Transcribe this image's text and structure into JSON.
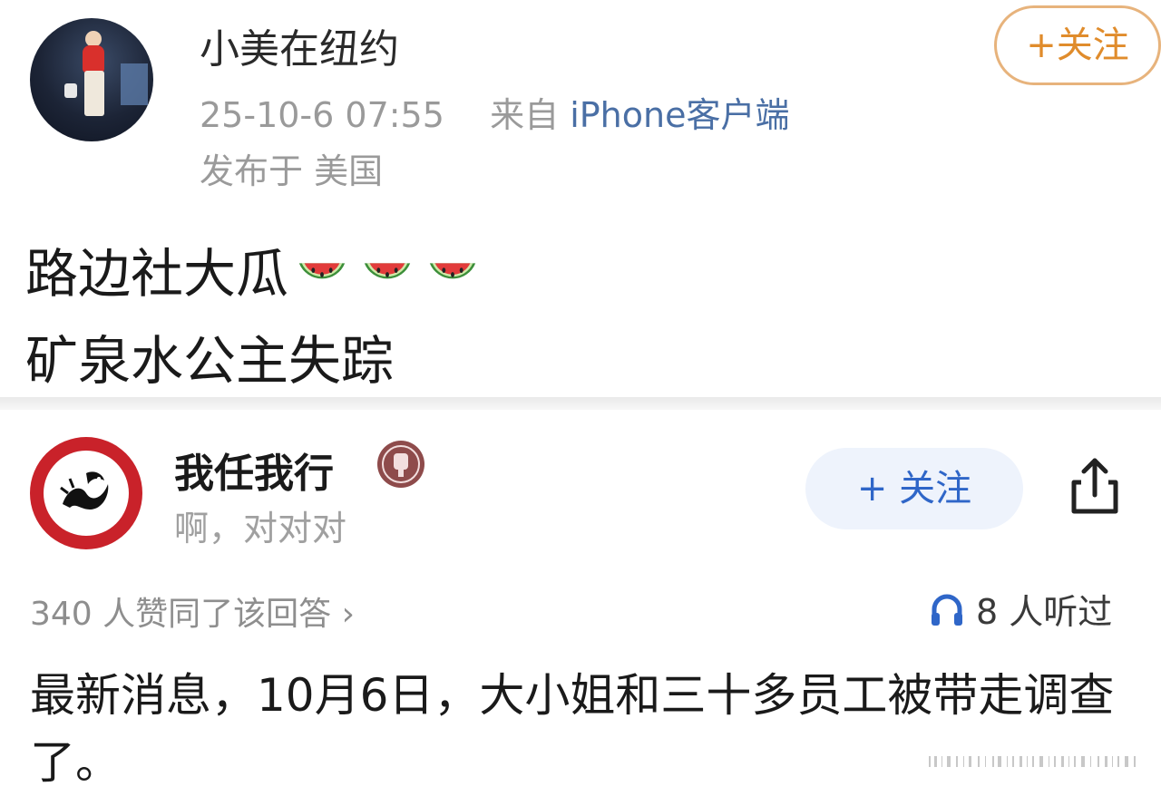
{
  "post1": {
    "author": "小美在纽约",
    "timestamp": "25-10-6 07:55",
    "from_label": "来自",
    "source": "iPhone客户端",
    "location": "发布于 美国",
    "follow_label": "+关注",
    "content_line1": "路边社大瓜",
    "content_line2": "矿泉水公主失踪",
    "emoji_icon": "watermelon-icon"
  },
  "post2": {
    "author": "我任我行",
    "subtitle": "啊，对对对",
    "follow_label": "+ 关注",
    "likes": "340 人赞同了该回答 ›",
    "listens": "8 人听过",
    "content": "最新消息，10月6日，大小姐和三十多员工被带走调查了。"
  },
  "colors": {
    "follow1_border": "#e7b37c",
    "follow1_text": "#e08c2c",
    "follow2_bg": "#eef3fc",
    "follow2_text": "#2f66c8",
    "source_link": "#4a6fa5"
  }
}
